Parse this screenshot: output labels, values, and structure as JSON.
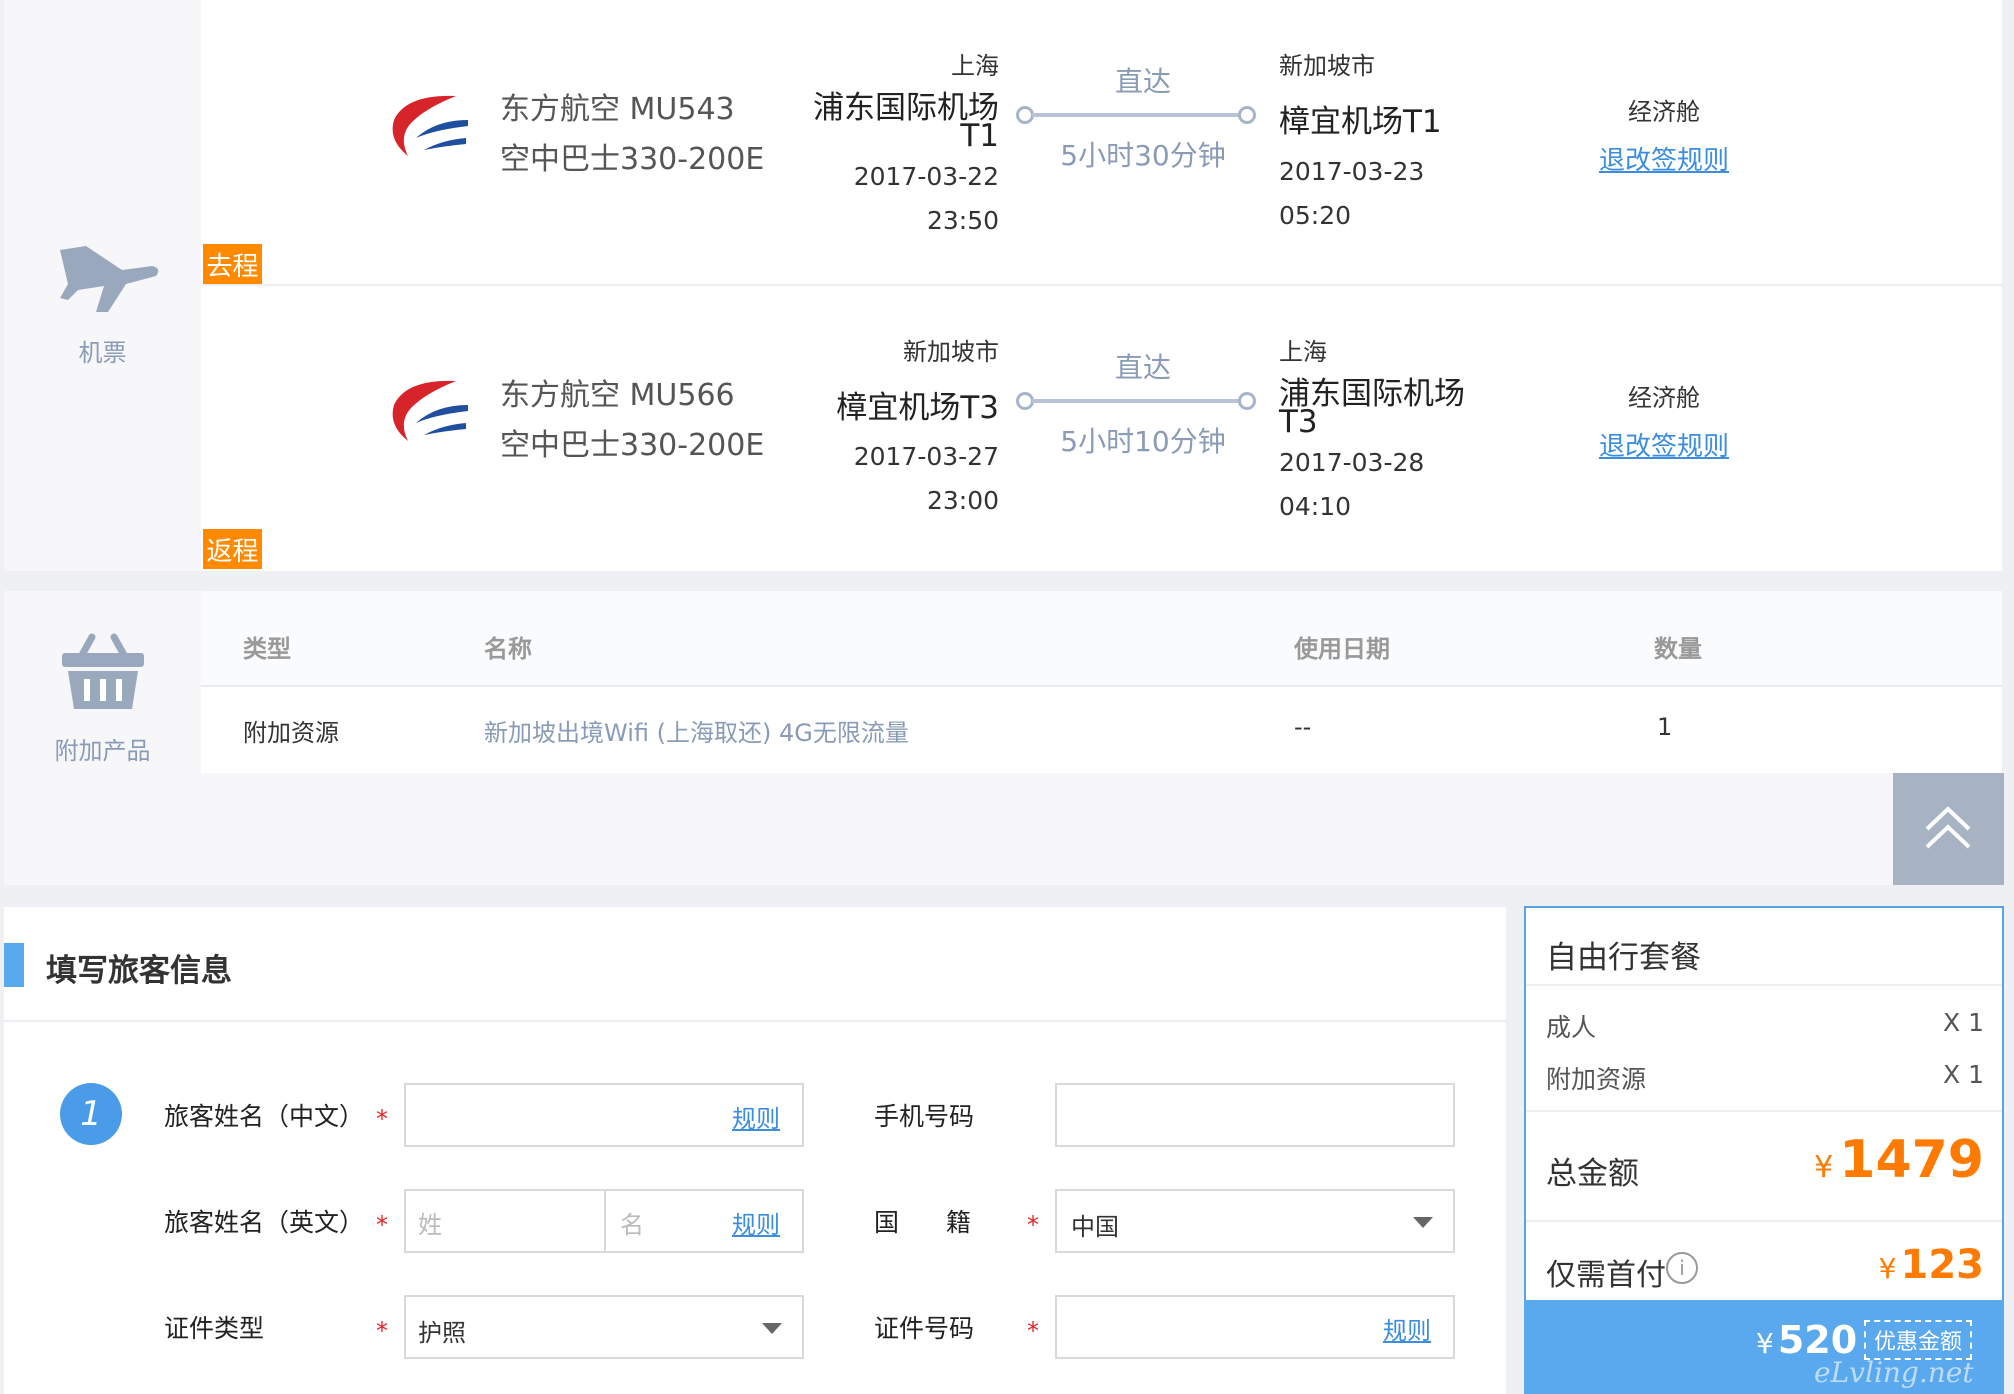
{
  "flights_section": {
    "icon": "airplane-icon",
    "label": "机票",
    "legs": [
      {
        "tag": "去程",
        "airline": "东方航空 MU543",
        "aircraft": "空中巴士330-200E",
        "dep_city": "上海",
        "dep_airport_line1": "浦东国际机场",
        "dep_airport_line2": "T1",
        "dep_date": "2017-03-22",
        "dep_time": "23:50",
        "stop": "直达",
        "duration": "5小时30分钟",
        "arr_city": "新加坡市",
        "arr_airport_line1": "樟宜机场T1",
        "arr_airport_line2": "",
        "arr_date": "2017-03-23",
        "arr_time": "05:20",
        "cabin": "经济舱",
        "rule_link": "退改签规则"
      },
      {
        "tag": "返程",
        "airline": "东方航空 MU566",
        "aircraft": "空中巴士330-200E",
        "dep_city": "新加坡市",
        "dep_airport_line1": "樟宜机场T3",
        "dep_airport_line2": "",
        "dep_date": "2017-03-27",
        "dep_time": "23:00",
        "stop": "直达",
        "duration": "5小时10分钟",
        "arr_city": "上海",
        "arr_airport_line1": "浦东国际机场",
        "arr_airport_line2": "T3",
        "arr_date": "2017-03-28",
        "arr_time": "04:10",
        "cabin": "经济舱",
        "rule_link": "退改签规则"
      }
    ]
  },
  "addon_section": {
    "icon": "basket-icon",
    "label": "附加产品",
    "headers": [
      "类型",
      "名称",
      "使用日期",
      "数量"
    ],
    "rows": [
      [
        "附加资源",
        "新加坡出境Wifi (上海取还) 4G无限流量",
        "--",
        "1"
      ]
    ]
  },
  "back_to_top_icon": "double-chevron-up-icon",
  "traveler_form": {
    "title": "填写旅客信息",
    "index": "1",
    "name_cn_label": "旅客姓名（中文）",
    "name_cn_rule": "规则",
    "phone_label": "手机号码",
    "name_en_label": "旅客姓名（英文）",
    "surname_placeholder": "姓",
    "given_placeholder": "名",
    "name_en_rule": "规则",
    "nationality_label_a": "国",
    "nationality_label_b": "籍",
    "nationality_value": "中国",
    "id_type_label": "证件类型",
    "id_type_value": "护照",
    "id_no_label": "证件号码",
    "id_no_rule": "规则",
    "required_mark": "*"
  },
  "summary": {
    "title": "自由行套餐",
    "items": [
      {
        "label": "成人",
        "qty": "X 1"
      },
      {
        "label": "附加资源",
        "qty": "X 1"
      }
    ],
    "total_label": "总金额",
    "currency": "¥",
    "total_value": "1479",
    "deposit_label": "仅需首付",
    "deposit_value": "123",
    "discount_value": "520",
    "discount_label": "优惠金额",
    "watermark": "eLvling.net"
  },
  "colors": {
    "accent_blue": "#5aa8ee",
    "tag_orange": "#ff8a00",
    "price_orange": "#ff7a00",
    "airline_red": "#d7232a",
    "airline_blue": "#1f4f9e"
  }
}
